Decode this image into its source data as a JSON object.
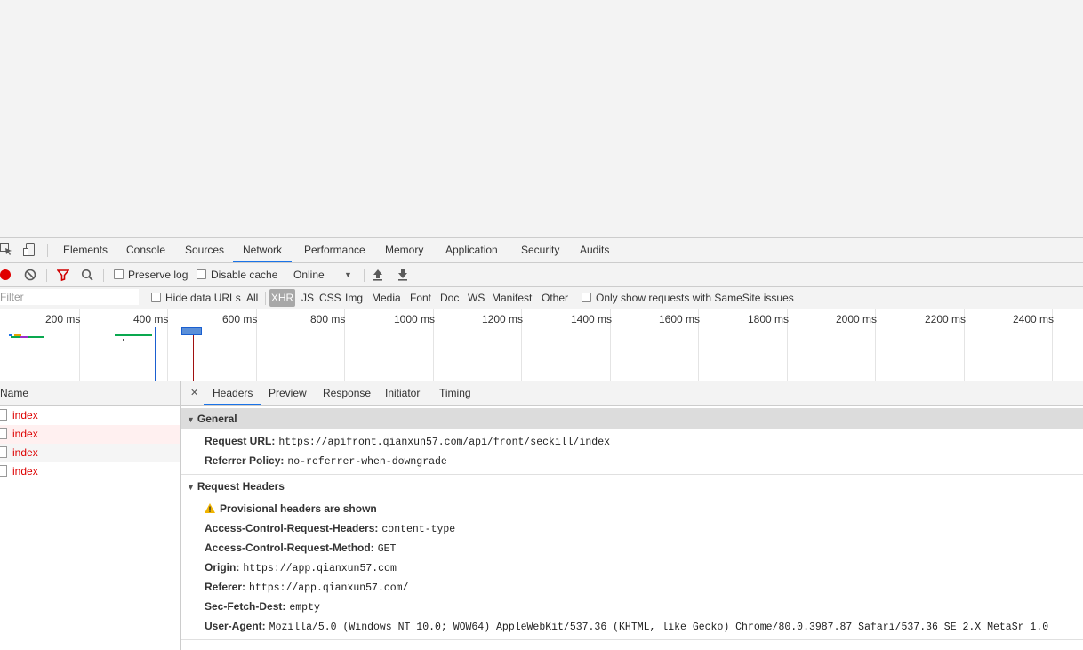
{
  "devtools": {
    "tabs": [
      "Elements",
      "Console",
      "Sources",
      "Network",
      "Performance",
      "Memory",
      "Application",
      "Security",
      "Audits"
    ],
    "active_tab": "Network",
    "colors": {
      "accent": "#1a73e8",
      "record": "#e00000",
      "filter_icon": "#d00000",
      "error_text": "#d00000"
    }
  },
  "toolbar": {
    "preserve_log": "Preserve log",
    "disable_cache": "Disable cache",
    "throttle_value": "Online",
    "throttle_arrow": "▼"
  },
  "filterbar": {
    "placeholder": "Filter",
    "hide_data_urls": "Hide data URLs",
    "types": [
      "All",
      "XHR",
      "JS",
      "CSS",
      "Img",
      "Media",
      "Font",
      "Doc",
      "WS",
      "Manifest",
      "Other"
    ],
    "active_type": "XHR",
    "samesite": "Only show requests with SameSite issues"
  },
  "overview": {
    "ticks": [
      "200 ms",
      "400 ms",
      "600 ms",
      "800 ms",
      "1000 ms",
      "1200 ms",
      "1400 ms",
      "1600 ms",
      "1800 ms",
      "2000 ms",
      "2200 ms",
      "2400 ms"
    ]
  },
  "requests": {
    "column_name": "Name",
    "rows": [
      "index",
      "index",
      "index",
      "index"
    ]
  },
  "details": {
    "close_glyph": "✕",
    "tabs": [
      "Headers",
      "Preview",
      "Response",
      "Initiator",
      "Timing"
    ],
    "active_tab": "Headers",
    "general": {
      "title": "General",
      "request_url_label": "Request URL:",
      "request_url": "https://apifront.qianxun57.com/api/front/seckill/index",
      "referrer_policy_label": "Referrer Policy:",
      "referrer_policy": "no-referrer-when-downgrade"
    },
    "request_headers": {
      "title": "Request Headers",
      "warning": "Provisional headers are shown",
      "items": [
        {
          "name": "Access-Control-Request-Headers:",
          "value": "content-type"
        },
        {
          "name": "Access-Control-Request-Method:",
          "value": "GET"
        },
        {
          "name": "Origin:",
          "value": "https://app.qianxun57.com"
        },
        {
          "name": "Referer:",
          "value": "https://app.qianxun57.com/"
        },
        {
          "name": "Sec-Fetch-Dest:",
          "value": "empty"
        },
        {
          "name": "User-Agent:",
          "value": "Mozilla/5.0 (Windows NT 10.0; WOW64) AppleWebKit/537.36 (KHTML, like Gecko) Chrome/80.0.3987.87 Safari/537.36 SE 2.X MetaSr 1.0"
        }
      ]
    }
  }
}
